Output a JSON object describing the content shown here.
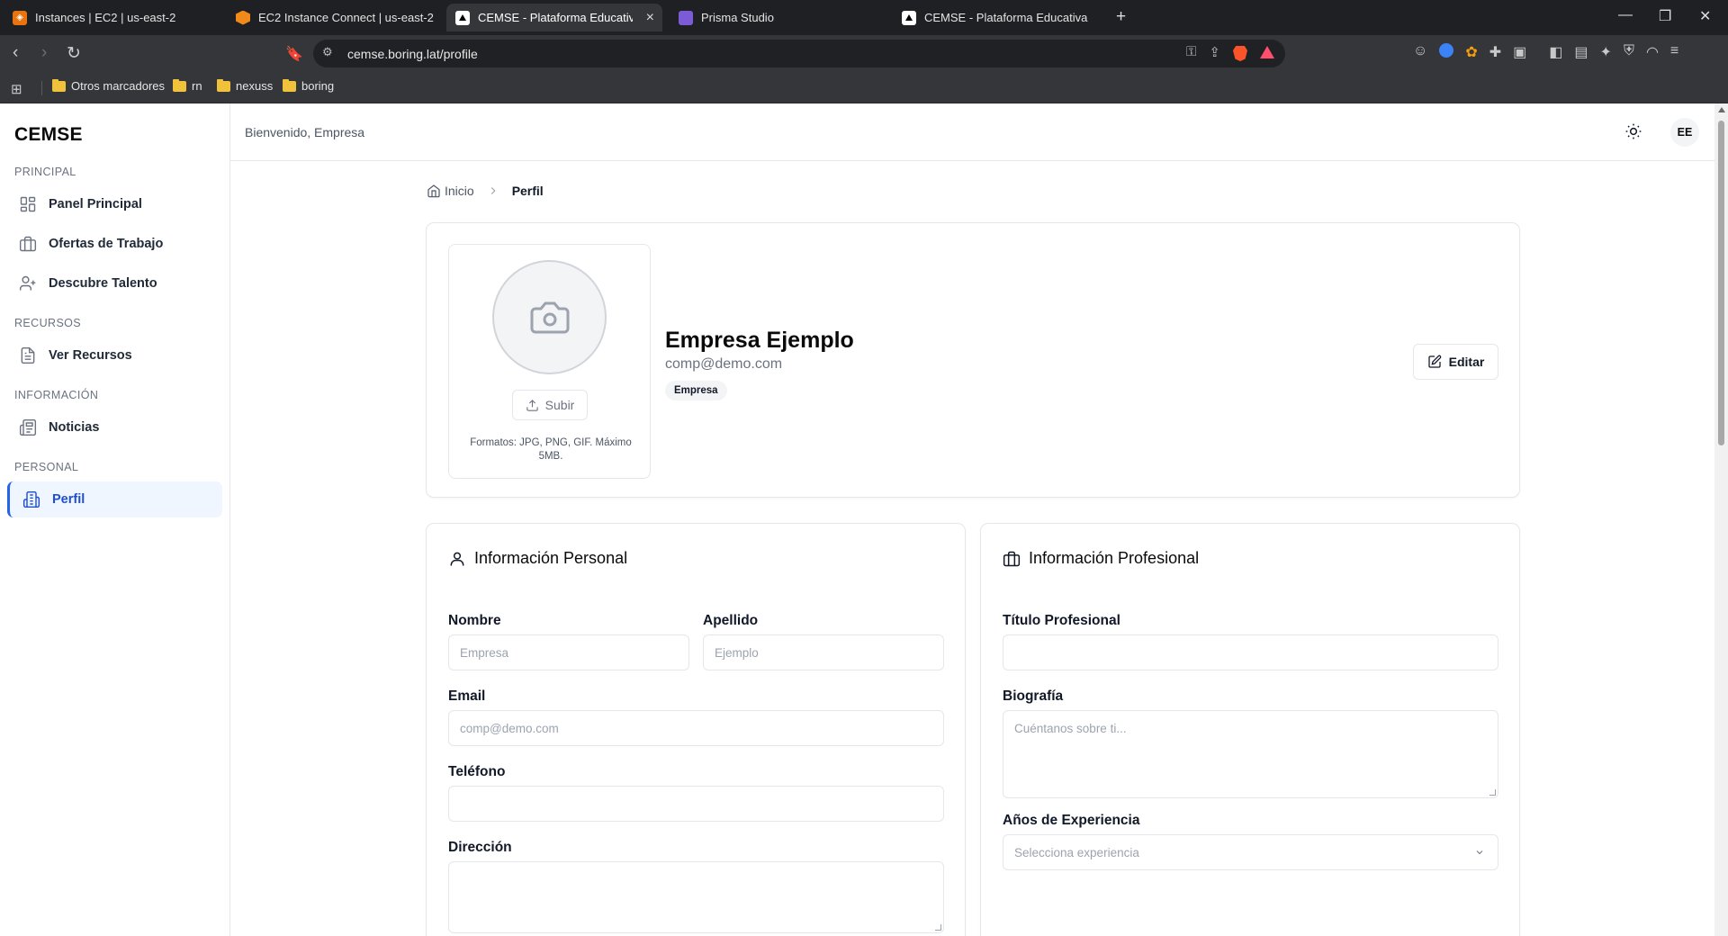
{
  "browser": {
    "tabs": [
      {
        "title": "Instances | EC2 | us-east-2",
        "icon": "aws-icon",
        "active": false
      },
      {
        "title": "EC2 Instance Connect | us-east-2",
        "icon": "aws-hex-icon",
        "active": false
      },
      {
        "title": "CEMSE - Plataforma Educativa y",
        "icon": "triangle-icon",
        "active": true
      },
      {
        "title": "Prisma Studio",
        "icon": "prisma-icon",
        "active": false
      },
      {
        "title": "CEMSE - Plataforma Educativa y de E",
        "icon": "triangle-icon",
        "active": false
      }
    ],
    "new_tab": "+",
    "url": "cemse.boring.lat/profile",
    "bookmarks": [
      "Otros marcadores",
      "rn",
      "nexuss",
      "boring"
    ],
    "colors": {
      "chrome_bg": "#1f2023",
      "toolbar_bg": "#35363a",
      "brave": "#fb542b"
    }
  },
  "sidebar": {
    "brand": "CEMSE",
    "sections": [
      {
        "label": "PRINCIPAL",
        "items": [
          {
            "label": "Panel Principal",
            "icon": "dashboard-icon"
          },
          {
            "label": "Ofertas de Trabajo",
            "icon": "briefcase-icon"
          },
          {
            "label": "Descubre Talento",
            "icon": "user-plus-icon"
          }
        ]
      },
      {
        "label": "RECURSOS",
        "items": [
          {
            "label": "Ver Recursos",
            "icon": "document-icon"
          }
        ]
      },
      {
        "label": "INFORMACIÓN",
        "items": [
          {
            "label": "Noticias",
            "icon": "newspaper-icon"
          }
        ]
      },
      {
        "label": "PERSONAL",
        "items": [
          {
            "label": "Perfil",
            "icon": "building-icon",
            "active": true
          }
        ]
      }
    ]
  },
  "header": {
    "welcome": "Bienvenido, Empresa",
    "avatar_initials": "EE"
  },
  "breadcrumb": {
    "home": "Inicio",
    "current": "Perfil"
  },
  "profile": {
    "upload_label": "Subir",
    "formats_note": "Formatos: JPG, PNG, GIF. Máximo 5MB.",
    "name": "Empresa Ejemplo",
    "email": "comp@demo.com",
    "role_badge": "Empresa",
    "edit_label": "Editar"
  },
  "personal_info": {
    "title": "Información Personal",
    "first_name": {
      "label": "Nombre",
      "placeholder": "Empresa"
    },
    "last_name": {
      "label": "Apellido",
      "placeholder": "Ejemplo"
    },
    "email": {
      "label": "Email",
      "placeholder": "comp@demo.com"
    },
    "phone": {
      "label": "Teléfono",
      "placeholder": ""
    },
    "address": {
      "label": "Dirección",
      "placeholder": ""
    }
  },
  "professional_info": {
    "title": "Información Profesional",
    "job_title": {
      "label": "Título Profesional",
      "placeholder": ""
    },
    "bio": {
      "label": "Biografía",
      "placeholder": "Cuéntanos sobre ti..."
    },
    "experience": {
      "label": "Años de Experiencia",
      "placeholder": "Selecciona experiencia"
    }
  },
  "theme": {
    "accent": "#2563eb",
    "active_bg": "#eff6ff",
    "border": "#e5e7eb"
  }
}
